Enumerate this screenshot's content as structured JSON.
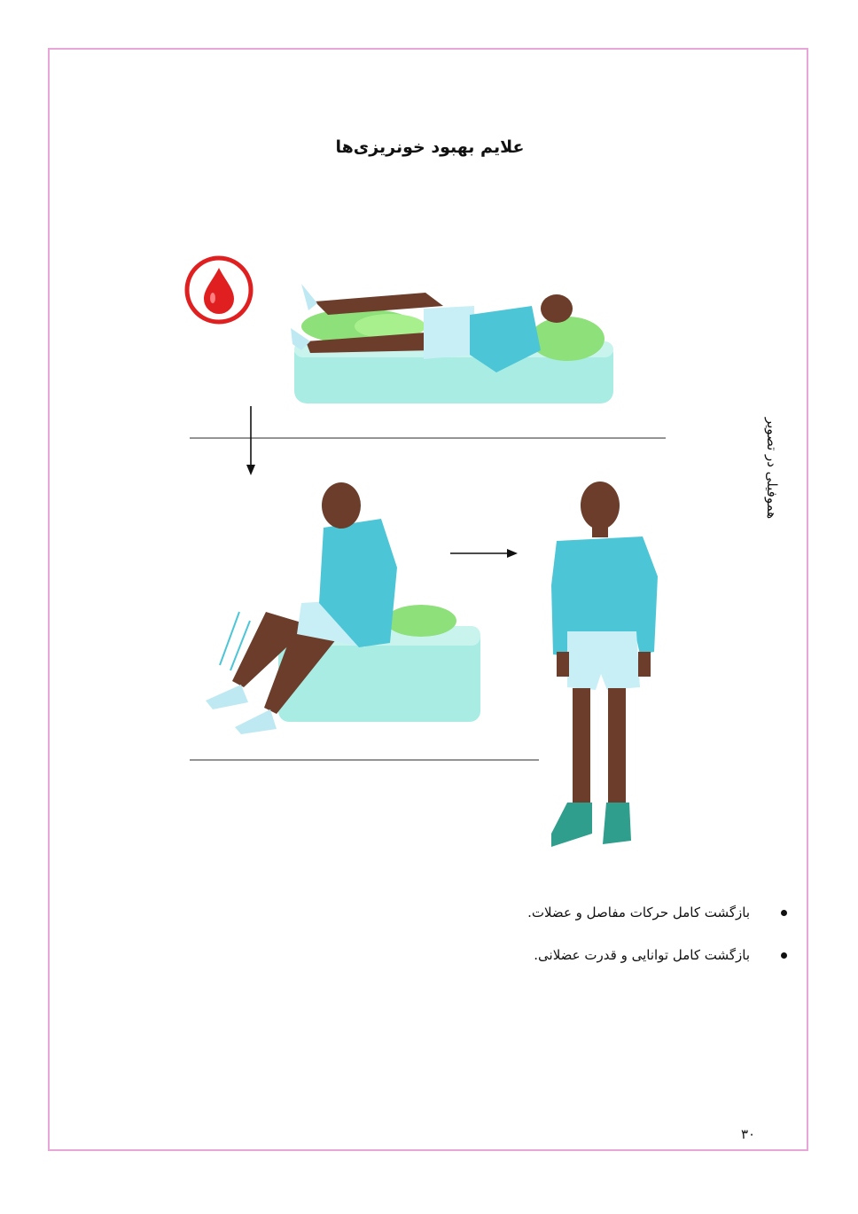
{
  "page": {
    "title": "علایم بهبود خونریزی‌ها",
    "side_label": "هموفیلی در تصویر",
    "page_number": "۳۰"
  },
  "illustrations": {
    "icon": "blood-drop-icon",
    "panels": [
      "person-lying-with-leg-on-pillow",
      "person-sitting-on-bed-moving-legs",
      "person-standing-walking"
    ]
  },
  "bullets": [
    "بازگشت کامل حرکات مفاصل و عضلات.",
    "بازگشت کامل توانایی و قدرت عضلانی."
  ],
  "colors": {
    "frame": "#e8a6d8",
    "drop": "#e02020",
    "shirt": "#4cc6d6",
    "bed": "#a8ece4",
    "pillow": "#8ee07a",
    "skin": "#6b3d2a"
  }
}
